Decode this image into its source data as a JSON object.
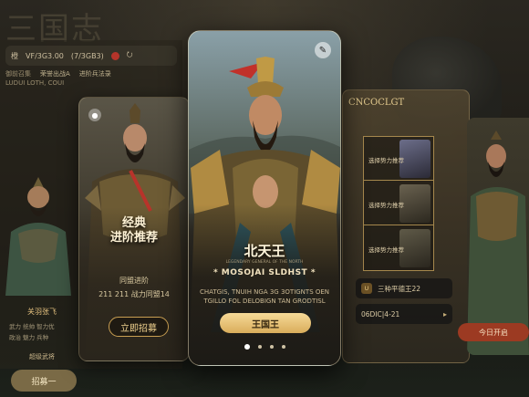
{
  "background": {
    "logo_text": "三国志"
  },
  "left_panel": {
    "stats": [
      "橙",
      "VF/3G3.00",
      "(7/3GB3)",
      "⚠",
      "⭮"
    ],
    "tags": [
      "御前召集",
      "荣誉出战A",
      "进阶兵法录"
    ],
    "tag_sub": "LUDUI LOTH, COUI",
    "hero_name": "关羽张飞",
    "lines": [
      "武力 统帅 智力优",
      "政治 魅力 兵种"
    ],
    "subtitle": "超级武将",
    "button": "招募一"
  },
  "card_left": {
    "title_line1": "经典",
    "title_line2": "进阶推荐",
    "stat1": "同盟进阶",
    "stat2": "211  211  战力同盟14",
    "button": "立即招募"
  },
  "card_center": {
    "title": "北天王",
    "tiny": "LEGENDARY GENERAL OF THE NORTH",
    "subtitle": "* MOSOJAI SLDHST *",
    "desc_line1": "CHATGIS, TNUIH NGA 3G 3OTIGNTS OEN",
    "desc_line2": "TGILLO FOL DELOBIGN TAN GRODTISL",
    "button": "王国王"
  },
  "right_panel": {
    "title": "CNCOCLGT",
    "list": [
      {
        "label": "选择势力推荐"
      },
      {
        "label": "选择势力推荐"
      },
      {
        "label": "选择势力推荐"
      }
    ],
    "rows": [
      {
        "icon": "U",
        "text": "三种平德王22"
      },
      {
        "icon": "",
        "text": "06DIC|4-21"
      }
    ]
  },
  "far_right": {
    "button": "今日开启"
  }
}
